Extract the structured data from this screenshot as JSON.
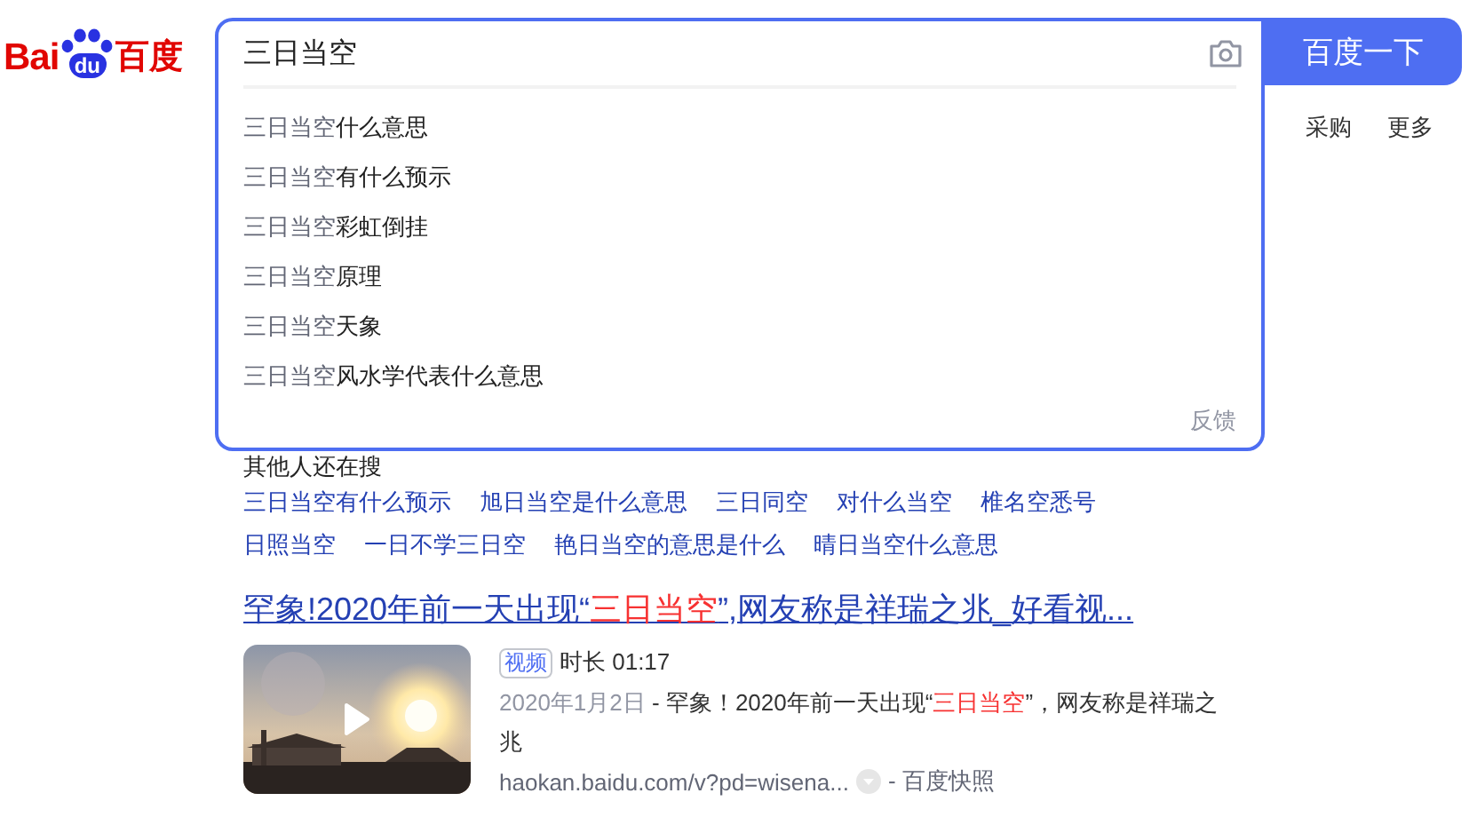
{
  "logo": {
    "latin": "Bai",
    "badge": "du",
    "chinese": "百度"
  },
  "search": {
    "value": "三日当空",
    "button": "百度一下"
  },
  "suggestions": [
    {
      "query": "三日当空",
      "rest": "什么意思"
    },
    {
      "query": "三日当空",
      "rest": "有什么预示"
    },
    {
      "query": "三日当空",
      "rest": "彩虹倒挂"
    },
    {
      "query": "三日当空",
      "rest": "原理"
    },
    {
      "query": "三日当空",
      "rest": "天象"
    },
    {
      "query": "三日当空",
      "rest": "风水学代表什么意思"
    }
  ],
  "feedback": "反馈",
  "nav": [
    "采购",
    "更多"
  ],
  "related": {
    "title": "其他人还在搜",
    "rows": [
      [
        "三日当空有什么预示",
        "旭日当空是什么意思",
        "三日同空",
        "对什么当空",
        "椎名空悉号"
      ],
      [
        "日照当空",
        "一日不学三日空",
        "艳日当空的意思是什么",
        "晴日当空什么意思"
      ]
    ]
  },
  "result": {
    "title_before": "罕象!2020年前一天出现“",
    "title_highlight": "三日当空",
    "title_after": "”,网友称是祥瑞之兆_好看视...",
    "tag": "视频",
    "duration": "时长 01:17",
    "date": "2020年1月2日",
    "desc_before": " - 罕象！2020年前一天出现“",
    "desc_highlight": "三日当空",
    "desc_after": "”，网友称是祥瑞之兆",
    "url": "haokan.baidu.com/v?pd=wisena...",
    "snapshot": "- 百度快照"
  }
}
